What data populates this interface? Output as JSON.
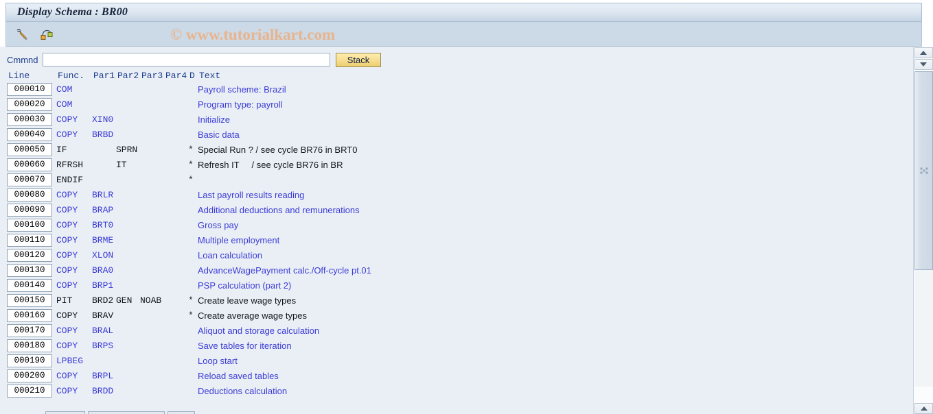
{
  "window": {
    "title": "Display Schema : BR00"
  },
  "toolbar": {
    "icons": [
      {
        "name": "edit-pencil-icon",
        "label": "Change"
      },
      {
        "name": "schema-structure-icon",
        "label": "Structure"
      }
    ],
    "watermark": "© www.tutorialkart.com"
  },
  "command": {
    "label": "Cmmnd",
    "value": "",
    "placeholder": "",
    "stack_label": "Stack"
  },
  "grid": {
    "headers": {
      "line": "Line",
      "func": "Func.",
      "par1": "Par1",
      "par2": "Par2",
      "par3": "Par3",
      "par4": "Par4",
      "d": "D",
      "text": "Text"
    },
    "rows": [
      {
        "line": "000010",
        "func": "COM",
        "par1": "",
        "par2": "",
        "par3": "",
        "par4": "",
        "d": "",
        "text": "Payroll scheme: Brazil",
        "style": "blue"
      },
      {
        "line": "000020",
        "func": "COM",
        "par1": "",
        "par2": "",
        "par3": "",
        "par4": "",
        "d": "",
        "text": "Program type: payroll",
        "style": "blue"
      },
      {
        "line": "000030",
        "func": "COPY",
        "par1": "XIN0",
        "par2": "",
        "par3": "",
        "par4": "",
        "d": "",
        "text": "Initialize",
        "style": "blue"
      },
      {
        "line": "000040",
        "func": "COPY",
        "par1": "BRBD",
        "par2": "",
        "par3": "",
        "par4": "",
        "d": "",
        "text": "Basic data",
        "style": "blue"
      },
      {
        "line": "000050",
        "func": "IF",
        "par1": "",
        "par2": "SPRN",
        "par3": "",
        "par4": "",
        "d": "*",
        "text": "Special Run ? / see cycle BR76 in BRT0",
        "style": "black"
      },
      {
        "line": "000060",
        "func": "RFRSH",
        "par1": "",
        "par2": "IT",
        "par3": "",
        "par4": "",
        "d": "*",
        "text": "Refresh IT     / see cycle BR76 in BR",
        "style": "black"
      },
      {
        "line": "000070",
        "func": "ENDIF",
        "par1": "",
        "par2": "",
        "par3": "",
        "par4": "",
        "d": "*",
        "text": "",
        "style": "black"
      },
      {
        "line": "000080",
        "func": "COPY",
        "par1": "BRLR",
        "par2": "",
        "par3": "",
        "par4": "",
        "d": "",
        "text": "Last payroll results reading",
        "style": "blue"
      },
      {
        "line": "000090",
        "func": "COPY",
        "par1": "BRAP",
        "par2": "",
        "par3": "",
        "par4": "",
        "d": "",
        "text": "Additional deductions and remunerations",
        "style": "blue"
      },
      {
        "line": "000100",
        "func": "COPY",
        "par1": "BRT0",
        "par2": "",
        "par3": "",
        "par4": "",
        "d": "",
        "text": "Gross pay",
        "style": "blue"
      },
      {
        "line": "000110",
        "func": "COPY",
        "par1": "BRME",
        "par2": "",
        "par3": "",
        "par4": "",
        "d": "",
        "text": "Multiple employment",
        "style": "blue"
      },
      {
        "line": "000120",
        "func": "COPY",
        "par1": "XLON",
        "par2": "",
        "par3": "",
        "par4": "",
        "d": "",
        "text": "Loan calculation",
        "style": "blue"
      },
      {
        "line": "000130",
        "func": "COPY",
        "par1": "BRA0",
        "par2": "",
        "par3": "",
        "par4": "",
        "d": "",
        "text": "AdvanceWagePayment calc./Off-cycle pt.01",
        "style": "blue"
      },
      {
        "line": "000140",
        "func": "COPY",
        "par1": "BRP1",
        "par2": "",
        "par3": "",
        "par4": "",
        "d": "",
        "text": "PSP calculation (part 2)",
        "style": "blue"
      },
      {
        "line": "000150",
        "func": "PIT",
        "par1": "BRD2",
        "par2": "GEN",
        "par3": "NOAB",
        "par4": "",
        "d": "*",
        "text": "Create leave wage types",
        "style": "black"
      },
      {
        "line": "000160",
        "func": "COPY",
        "par1": "BRAV",
        "par2": "",
        "par3": "",
        "par4": "",
        "d": "*",
        "text": "Create average wage types",
        "style": "black"
      },
      {
        "line": "000170",
        "func": "COPY",
        "par1": "BRAL",
        "par2": "",
        "par3": "",
        "par4": "",
        "d": "",
        "text": "Aliquot and storage calculation",
        "style": "blue"
      },
      {
        "line": "000180",
        "func": "COPY",
        "par1": "BRPS",
        "par2": "",
        "par3": "",
        "par4": "",
        "d": "",
        "text": "Save tables for iteration",
        "style": "blue"
      },
      {
        "line": "000190",
        "func": "LPBEG",
        "par1": "",
        "par2": "",
        "par3": "",
        "par4": "",
        "d": "",
        "text": "Loop start",
        "style": "blue"
      },
      {
        "line": "000200",
        "func": "COPY",
        "par1": "BRPL",
        "par2": "",
        "par3": "",
        "par4": "",
        "d": "",
        "text": "Reload saved tables",
        "style": "blue"
      },
      {
        "line": "000210",
        "func": "COPY",
        "par1": "BRDD",
        "par2": "",
        "par3": "",
        "par4": "",
        "d": "",
        "text": "Deductions calculation",
        "style": "blue"
      }
    ]
  },
  "scrollbar": {
    "up_label": "Scroll up",
    "down_label": "Scroll down",
    "page_down_label": "Page down"
  },
  "colors": {
    "title_text": "#18243a",
    "label_blue": "#1a3b8c",
    "code_blue": "#3b3bd6",
    "code_black": "#12161c",
    "canvas_bg": "#eaeff5",
    "toolbar_bg": "#ccd9e6",
    "stack_button": "#f6dd8e",
    "watermark": "#e8b48d"
  }
}
